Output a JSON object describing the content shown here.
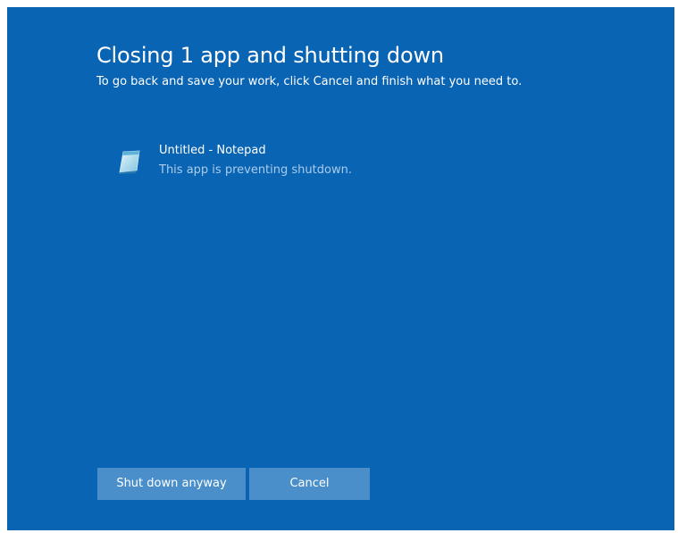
{
  "dialog": {
    "title": "Closing 1 app and shutting down",
    "subtitle": "To go back and save your work, click Cancel and finish what you need to."
  },
  "apps": [
    {
      "name": "Untitled - Notepad",
      "status": "This app is preventing shutdown.",
      "icon": "notepad-icon"
    }
  ],
  "buttons": {
    "shutdown_label": "Shut down anyway",
    "cancel_label": "Cancel"
  },
  "colors": {
    "background": "#0a64b4",
    "button": "#4b8fca",
    "secondary_text": "#a9ccec"
  }
}
